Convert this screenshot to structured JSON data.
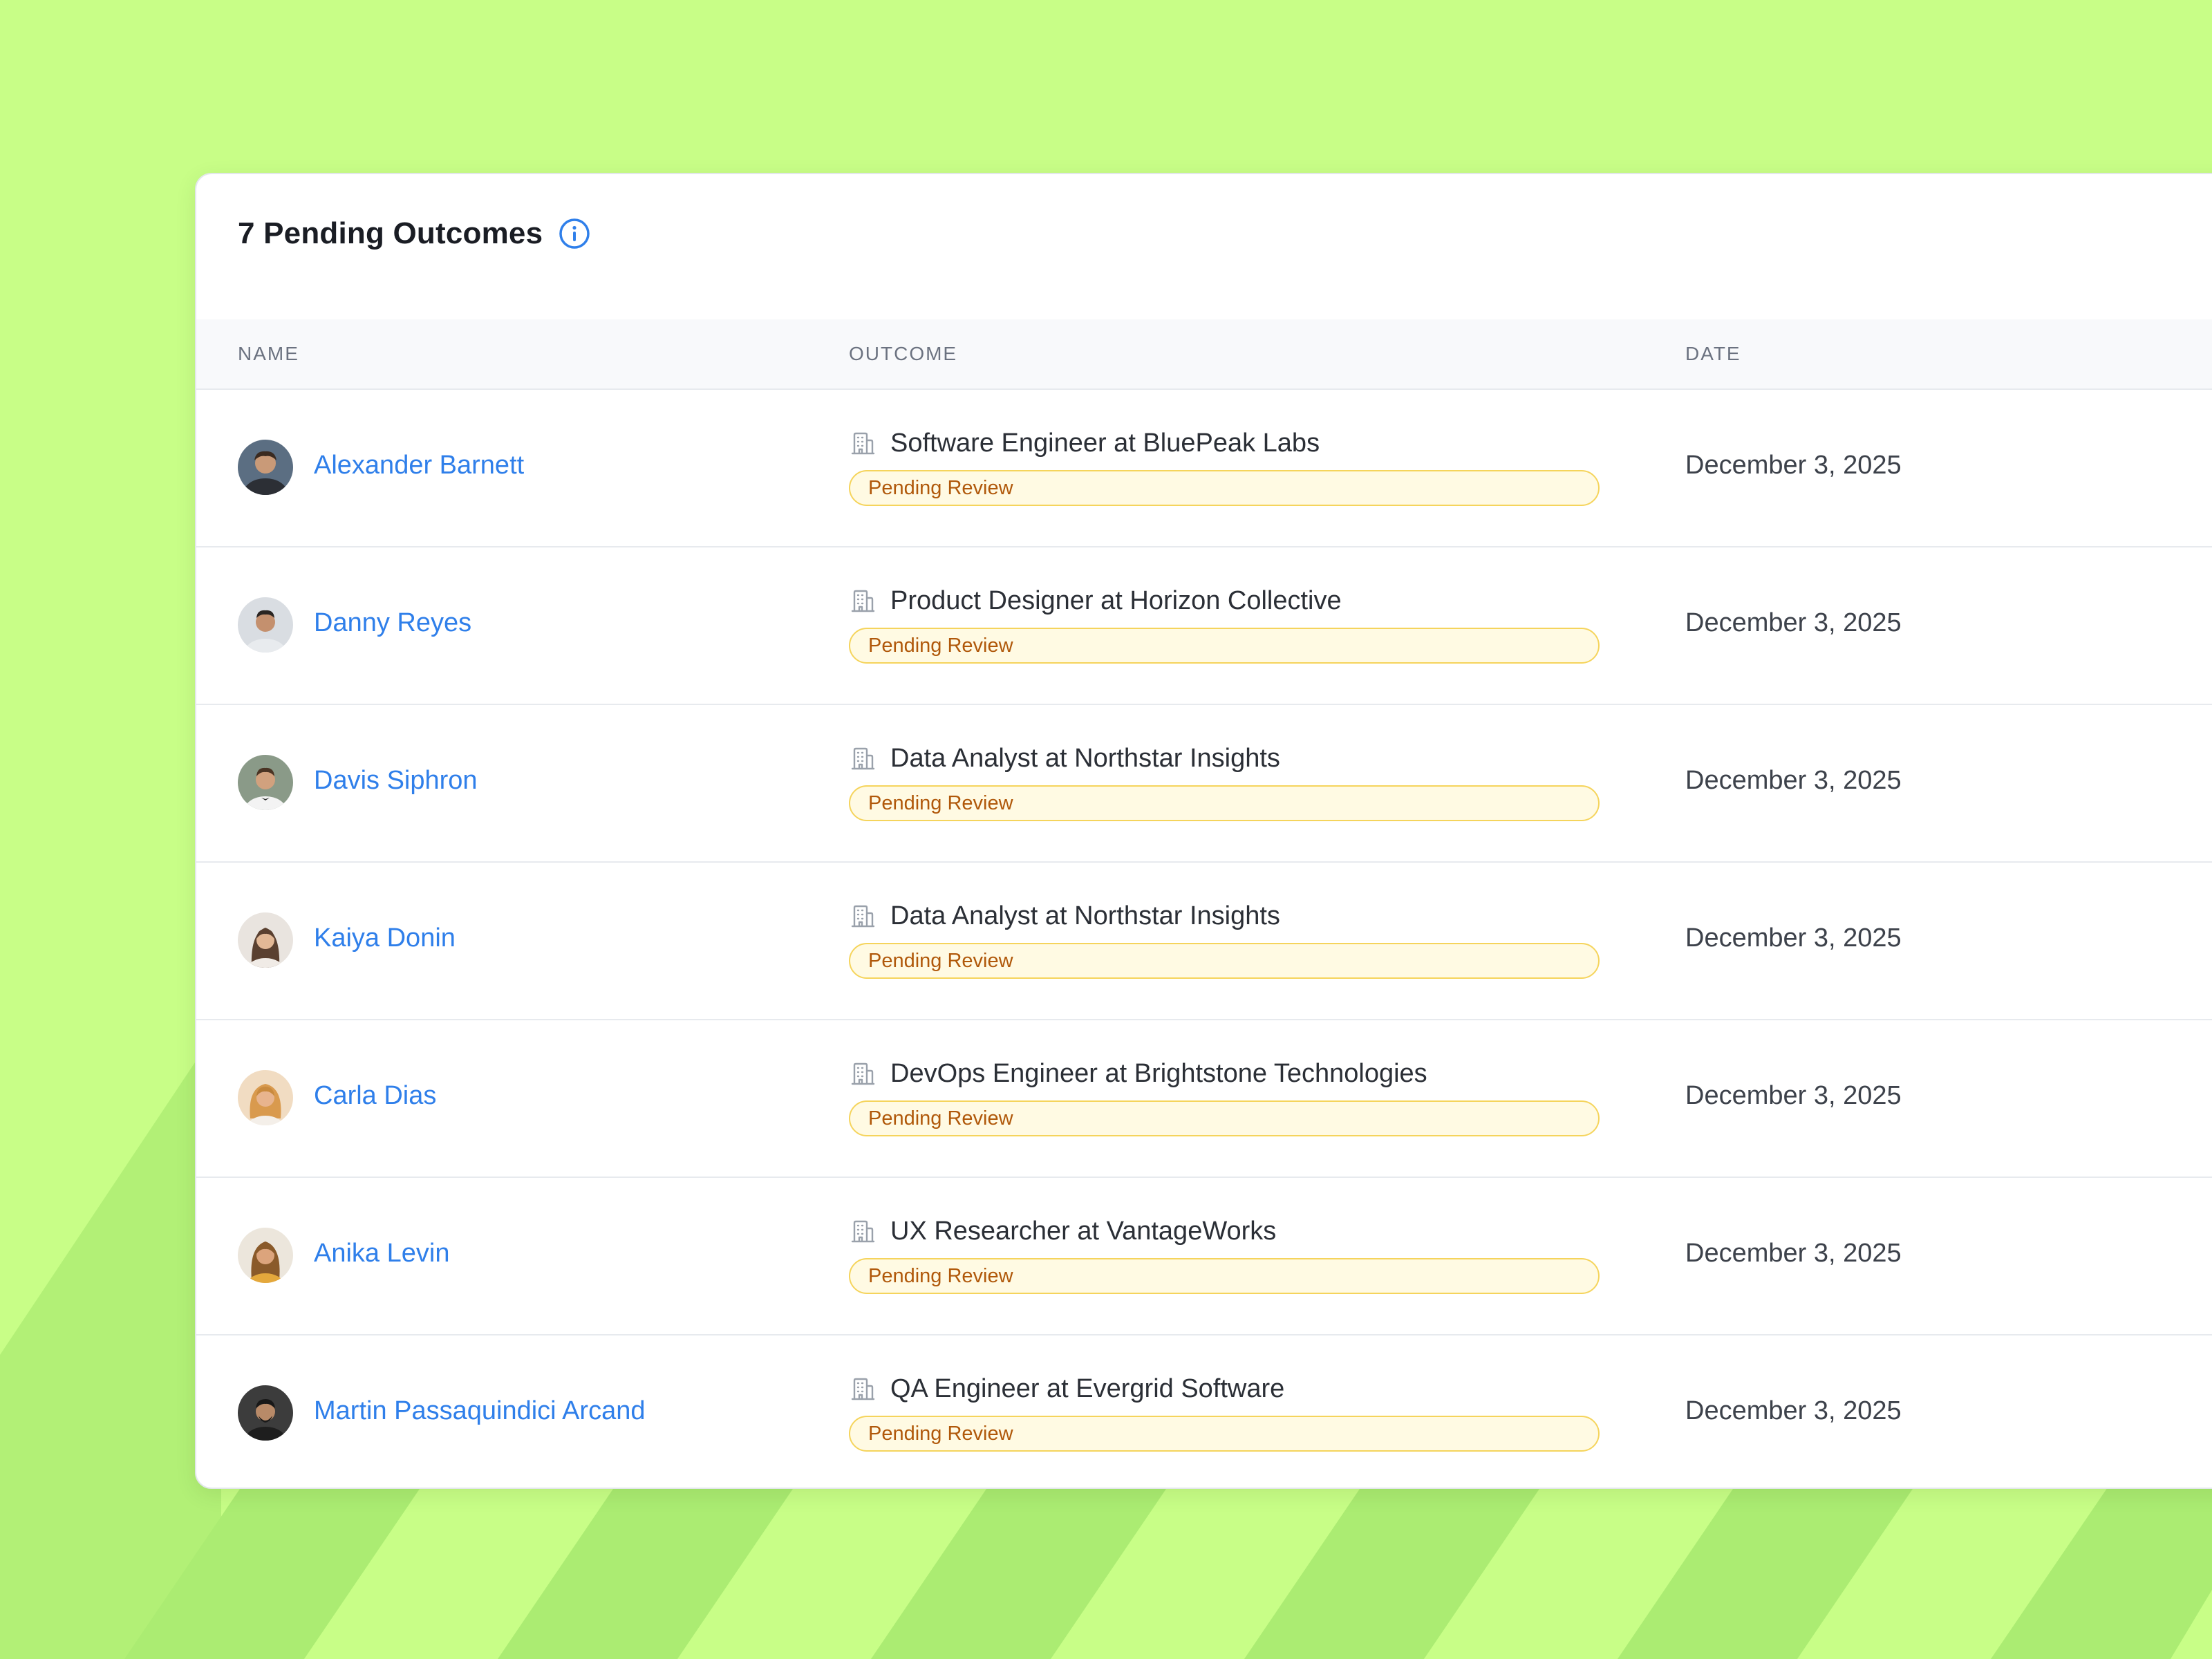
{
  "colors": {
    "background": "#c8fe87",
    "background_stripe": "#abec72",
    "link": "#2f7fea",
    "badge_border": "#f5d45c",
    "badge_fill": "#fffae3",
    "badge_text": "#b0580a"
  },
  "header": {
    "title": "7 Pending Outcomes",
    "info_icon": "info-circle-icon"
  },
  "table": {
    "columns": [
      "NAME",
      "OUTCOME",
      "DATE"
    ],
    "outcome_icon": "building-icon",
    "rows": [
      {
        "name": "Alexander Barnett",
        "outcome": "Software Engineer at BluePeak Labs",
        "status": "Pending Review",
        "date": "December 3, 2025",
        "avatar_icon": "avatar-photo"
      },
      {
        "name": "Danny Reyes",
        "outcome": "Product Designer at Horizon Collective",
        "status": "Pending Review",
        "date": "December 3, 2025",
        "avatar_icon": "avatar-photo"
      },
      {
        "name": "Davis Siphron",
        "outcome": "Data Analyst at Northstar Insights",
        "status": "Pending Review",
        "date": "December 3, 2025",
        "avatar_icon": "avatar-photo"
      },
      {
        "name": "Kaiya Donin",
        "outcome": "Data Analyst at Northstar Insights",
        "status": "Pending Review",
        "date": "December 3, 2025",
        "avatar_icon": "avatar-photo"
      },
      {
        "name": "Carla Dias",
        "outcome": "DevOps Engineer at Brightstone Technologies",
        "status": "Pending Review",
        "date": "December 3, 2025",
        "avatar_icon": "avatar-photo"
      },
      {
        "name": "Anika Levin",
        "outcome": "UX Researcher at VantageWorks",
        "status": "Pending Review",
        "date": "December 3, 2025",
        "avatar_icon": "avatar-photo"
      },
      {
        "name": "Martin Passaquindici Arcand",
        "outcome": "QA Engineer at Evergrid Software",
        "status": "Pending Review",
        "date": "December 3, 2025",
        "avatar_icon": "avatar-photo"
      }
    ]
  }
}
